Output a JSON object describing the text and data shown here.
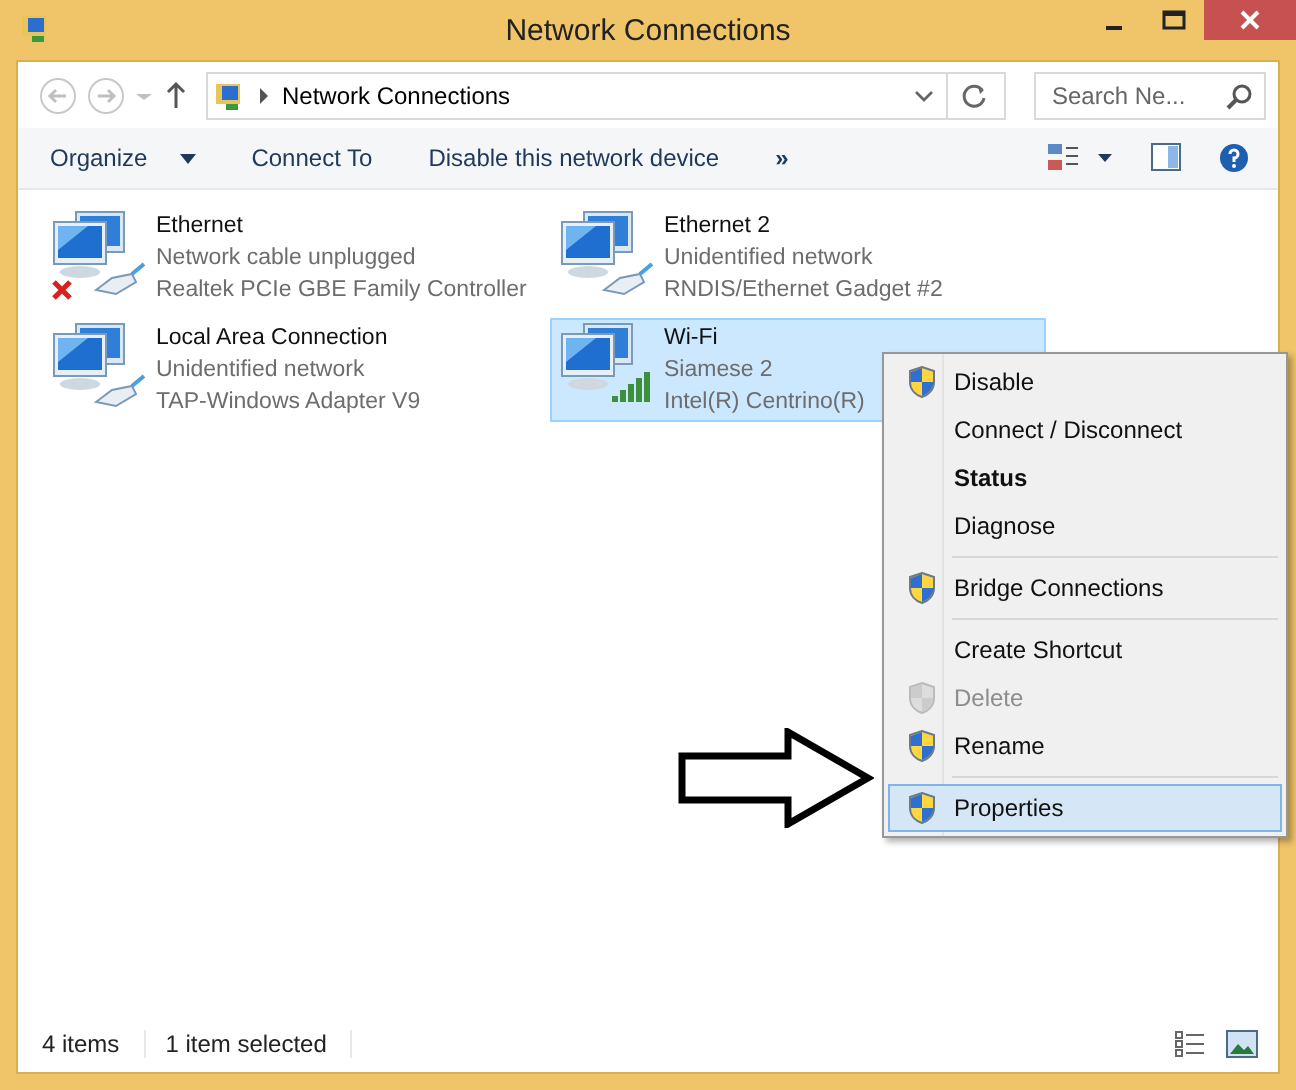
{
  "window": {
    "title": "Network Connections"
  },
  "address_bar": {
    "path": "Network Connections"
  },
  "search": {
    "placeholder": "Search Ne..."
  },
  "toolbar": {
    "items": [
      {
        "label": "Organize",
        "dropdown": true
      },
      {
        "label": "Connect To",
        "dropdown": false
      },
      {
        "label": "Disable this network device",
        "dropdown": false
      }
    ],
    "overflow": "»"
  },
  "connections": [
    {
      "name": "Ethernet",
      "status": "Network cable unplugged",
      "adapter": "Realtek PCIe GBE Family Controller",
      "kind": "wired",
      "unplugged": true,
      "selected": false
    },
    {
      "name": "Ethernet 2",
      "status": "Unidentified network",
      "adapter": "RNDIS/Ethernet Gadget #2",
      "kind": "wired",
      "unplugged": false,
      "selected": false
    },
    {
      "name": "Local Area Connection",
      "status": "Unidentified network",
      "adapter": "TAP-Windows Adapter V9",
      "kind": "wired",
      "unplugged": false,
      "selected": false
    },
    {
      "name": "Wi-Fi",
      "status": "Siamese  2",
      "adapter": "Intel(R) Centrino(R)",
      "kind": "wireless",
      "unplugged": false,
      "selected": true
    }
  ],
  "context_menu": {
    "items": [
      {
        "kind": "item",
        "label": "Disable",
        "shield": true,
        "bold": false,
        "disabled": false,
        "selected": false
      },
      {
        "kind": "item",
        "label": "Connect / Disconnect",
        "shield": false,
        "bold": false,
        "disabled": false,
        "selected": false
      },
      {
        "kind": "item",
        "label": "Status",
        "shield": false,
        "bold": true,
        "disabled": false,
        "selected": false
      },
      {
        "kind": "item",
        "label": "Diagnose",
        "shield": false,
        "bold": false,
        "disabled": false,
        "selected": false
      },
      {
        "kind": "separator"
      },
      {
        "kind": "item",
        "label": "Bridge Connections",
        "shield": true,
        "bold": false,
        "disabled": false,
        "selected": false
      },
      {
        "kind": "separator"
      },
      {
        "kind": "item",
        "label": "Create Shortcut",
        "shield": false,
        "bold": false,
        "disabled": false,
        "selected": false
      },
      {
        "kind": "item",
        "label": "Delete",
        "shield": true,
        "bold": false,
        "disabled": true,
        "selected": false
      },
      {
        "kind": "item",
        "label": "Rename",
        "shield": true,
        "bold": false,
        "disabled": false,
        "selected": false
      },
      {
        "kind": "separator"
      },
      {
        "kind": "item",
        "label": "Properties",
        "shield": true,
        "bold": false,
        "disabled": false,
        "selected": true
      }
    ]
  },
  "status_bar": {
    "item_count": "4 items",
    "selection": "1 item selected"
  }
}
